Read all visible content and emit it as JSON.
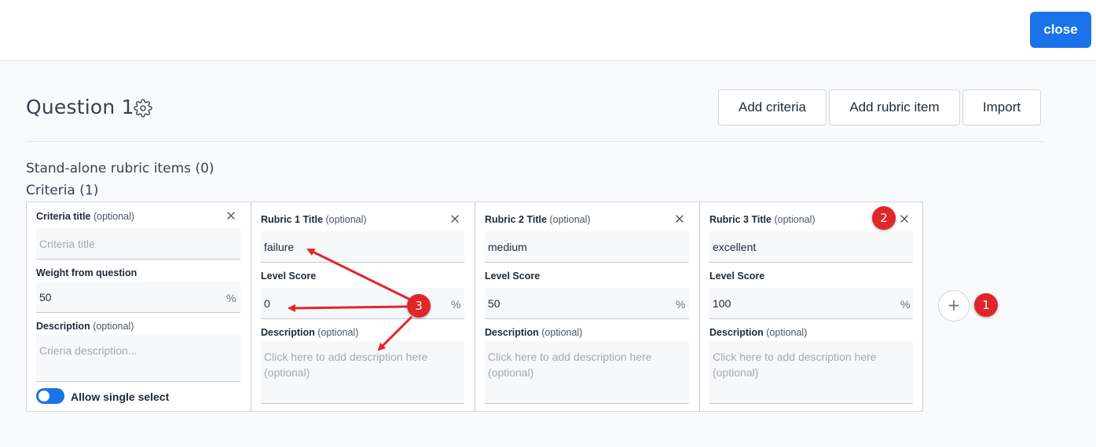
{
  "topbar": {
    "close_label": "close"
  },
  "question": {
    "title": "Question 1",
    "actions": {
      "add_criteria": "Add criteria",
      "add_rubric_item": "Add rubric item",
      "import": "Import"
    }
  },
  "sections": {
    "standalone_label": "Stand-alone rubric items (0)",
    "criteria_label": "Criteria (1)"
  },
  "criteria": {
    "title_label": "Criteria title",
    "optional": "(optional)",
    "title_placeholder": "Criteria title",
    "weight_label": "Weight from question",
    "weight_value": "50",
    "percent": "%",
    "description_label": "Description",
    "description_placeholder": "Crieria description...",
    "allow_single_select": "Allow single select",
    "allow_single_select_on": true
  },
  "rubrics": [
    {
      "title_label": "Rubric 1 Title",
      "optional": "(optional)",
      "title_value": "failure",
      "score_label": "Level Score",
      "score_value": "0",
      "percent": "%",
      "description_label": "Description",
      "description_placeholder": "Click here to add description here (optional)"
    },
    {
      "title_label": "Rubric 2 Title",
      "optional": "(optional)",
      "title_value": "medium",
      "score_label": "Level Score",
      "score_value": "50",
      "percent": "%",
      "description_label": "Description",
      "description_placeholder": "Click here to add description here (optional)"
    },
    {
      "title_label": "Rubric 3 Title",
      "optional": "(optional)",
      "title_value": "excellent",
      "score_label": "Level Score",
      "score_value": "100",
      "percent": "%",
      "description_label": "Description",
      "description_placeholder": "Click here to add description here (optional)"
    }
  ],
  "add_rubric_symbol": "+",
  "annotations": {
    "badge_1": "1",
    "badge_2": "2",
    "badge_3": "3",
    "color": "#e1262b"
  },
  "colors": {
    "primary": "#1a73e8",
    "annotation": "#e1262b"
  }
}
